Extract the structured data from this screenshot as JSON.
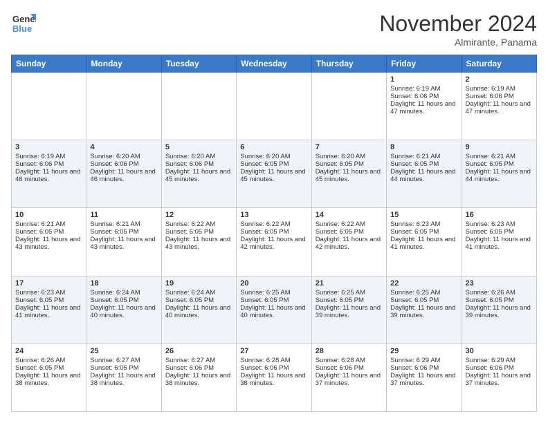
{
  "header": {
    "logo_line1": "General",
    "logo_line2": "Blue",
    "month": "November 2024",
    "location": "Almirante, Panama"
  },
  "days_of_week": [
    "Sunday",
    "Monday",
    "Tuesday",
    "Wednesday",
    "Thursday",
    "Friday",
    "Saturday"
  ],
  "weeks": [
    [
      {
        "day": "",
        "sunrise": "",
        "sunset": "",
        "daylight": ""
      },
      {
        "day": "",
        "sunrise": "",
        "sunset": "",
        "daylight": ""
      },
      {
        "day": "",
        "sunrise": "",
        "sunset": "",
        "daylight": ""
      },
      {
        "day": "",
        "sunrise": "",
        "sunset": "",
        "daylight": ""
      },
      {
        "day": "",
        "sunrise": "",
        "sunset": "",
        "daylight": ""
      },
      {
        "day": "1",
        "sunrise": "Sunrise: 6:19 AM",
        "sunset": "Sunset: 6:06 PM",
        "daylight": "Daylight: 11 hours and 47 minutes."
      },
      {
        "day": "2",
        "sunrise": "Sunrise: 6:19 AM",
        "sunset": "Sunset: 6:06 PM",
        "daylight": "Daylight: 11 hours and 47 minutes."
      }
    ],
    [
      {
        "day": "3",
        "sunrise": "Sunrise: 6:19 AM",
        "sunset": "Sunset: 6:06 PM",
        "daylight": "Daylight: 11 hours and 46 minutes."
      },
      {
        "day": "4",
        "sunrise": "Sunrise: 6:20 AM",
        "sunset": "Sunset: 6:06 PM",
        "daylight": "Daylight: 11 hours and 46 minutes."
      },
      {
        "day": "5",
        "sunrise": "Sunrise: 6:20 AM",
        "sunset": "Sunset: 6:06 PM",
        "daylight": "Daylight: 11 hours and 45 minutes."
      },
      {
        "day": "6",
        "sunrise": "Sunrise: 6:20 AM",
        "sunset": "Sunset: 6:05 PM",
        "daylight": "Daylight: 11 hours and 45 minutes."
      },
      {
        "day": "7",
        "sunrise": "Sunrise: 6:20 AM",
        "sunset": "Sunset: 6:05 PM",
        "daylight": "Daylight: 11 hours and 45 minutes."
      },
      {
        "day": "8",
        "sunrise": "Sunrise: 6:21 AM",
        "sunset": "Sunset: 6:05 PM",
        "daylight": "Daylight: 11 hours and 44 minutes."
      },
      {
        "day": "9",
        "sunrise": "Sunrise: 6:21 AM",
        "sunset": "Sunset: 6:05 PM",
        "daylight": "Daylight: 11 hours and 44 minutes."
      }
    ],
    [
      {
        "day": "10",
        "sunrise": "Sunrise: 6:21 AM",
        "sunset": "Sunset: 6:05 PM",
        "daylight": "Daylight: 11 hours and 43 minutes."
      },
      {
        "day": "11",
        "sunrise": "Sunrise: 6:21 AM",
        "sunset": "Sunset: 6:05 PM",
        "daylight": "Daylight: 11 hours and 43 minutes."
      },
      {
        "day": "12",
        "sunrise": "Sunrise: 6:22 AM",
        "sunset": "Sunset: 6:05 PM",
        "daylight": "Daylight: 11 hours and 43 minutes."
      },
      {
        "day": "13",
        "sunrise": "Sunrise: 6:22 AM",
        "sunset": "Sunset: 6:05 PM",
        "daylight": "Daylight: 11 hours and 42 minutes."
      },
      {
        "day": "14",
        "sunrise": "Sunrise: 6:22 AM",
        "sunset": "Sunset: 6:05 PM",
        "daylight": "Daylight: 11 hours and 42 minutes."
      },
      {
        "day": "15",
        "sunrise": "Sunrise: 6:23 AM",
        "sunset": "Sunset: 6:05 PM",
        "daylight": "Daylight: 11 hours and 41 minutes."
      },
      {
        "day": "16",
        "sunrise": "Sunrise: 6:23 AM",
        "sunset": "Sunset: 6:05 PM",
        "daylight": "Daylight: 11 hours and 41 minutes."
      }
    ],
    [
      {
        "day": "17",
        "sunrise": "Sunrise: 6:23 AM",
        "sunset": "Sunset: 6:05 PM",
        "daylight": "Daylight: 11 hours and 41 minutes."
      },
      {
        "day": "18",
        "sunrise": "Sunrise: 6:24 AM",
        "sunset": "Sunset: 6:05 PM",
        "daylight": "Daylight: 11 hours and 40 minutes."
      },
      {
        "day": "19",
        "sunrise": "Sunrise: 6:24 AM",
        "sunset": "Sunset: 6:05 PM",
        "daylight": "Daylight: 11 hours and 40 minutes."
      },
      {
        "day": "20",
        "sunrise": "Sunrise: 6:25 AM",
        "sunset": "Sunset: 6:05 PM",
        "daylight": "Daylight: 11 hours and 40 minutes."
      },
      {
        "day": "21",
        "sunrise": "Sunrise: 6:25 AM",
        "sunset": "Sunset: 6:05 PM",
        "daylight": "Daylight: 11 hours and 39 minutes."
      },
      {
        "day": "22",
        "sunrise": "Sunrise: 6:25 AM",
        "sunset": "Sunset: 6:05 PM",
        "daylight": "Daylight: 11 hours and 39 minutes."
      },
      {
        "day": "23",
        "sunrise": "Sunrise: 6:26 AM",
        "sunset": "Sunset: 6:05 PM",
        "daylight": "Daylight: 11 hours and 39 minutes."
      }
    ],
    [
      {
        "day": "24",
        "sunrise": "Sunrise: 6:26 AM",
        "sunset": "Sunset: 6:05 PM",
        "daylight": "Daylight: 11 hours and 38 minutes."
      },
      {
        "day": "25",
        "sunrise": "Sunrise: 6:27 AM",
        "sunset": "Sunset: 6:05 PM",
        "daylight": "Daylight: 11 hours and 38 minutes."
      },
      {
        "day": "26",
        "sunrise": "Sunrise: 6:27 AM",
        "sunset": "Sunset: 6:06 PM",
        "daylight": "Daylight: 11 hours and 38 minutes."
      },
      {
        "day": "27",
        "sunrise": "Sunrise: 6:28 AM",
        "sunset": "Sunset: 6:06 PM",
        "daylight": "Daylight: 11 hours and 38 minutes."
      },
      {
        "day": "28",
        "sunrise": "Sunrise: 6:28 AM",
        "sunset": "Sunset: 6:06 PM",
        "daylight": "Daylight: 11 hours and 37 minutes."
      },
      {
        "day": "29",
        "sunrise": "Sunrise: 6:29 AM",
        "sunset": "Sunset: 6:06 PM",
        "daylight": "Daylight: 11 hours and 37 minutes."
      },
      {
        "day": "30",
        "sunrise": "Sunrise: 6:29 AM",
        "sunset": "Sunset: 6:06 PM",
        "daylight": "Daylight: 11 hours and 37 minutes."
      }
    ]
  ]
}
